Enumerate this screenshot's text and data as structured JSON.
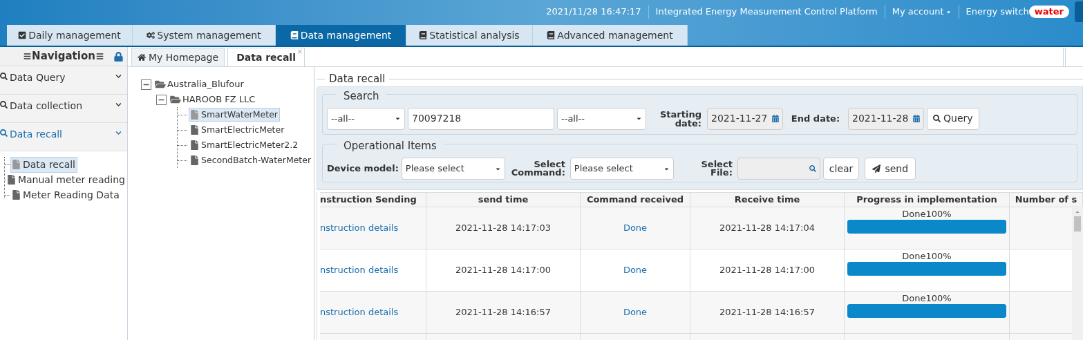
{
  "header": {
    "datetime": "2021/11/28 16:47:17",
    "platform": "Integrated Energy Measurement Control Platform",
    "account": "My account",
    "energy_label": "Energy switch",
    "energy_value": "water"
  },
  "top_tabs": [
    {
      "label": "Daily management",
      "selected": false
    },
    {
      "label": "System management",
      "selected": false
    },
    {
      "label": "Data management",
      "selected": true
    },
    {
      "label": "Statistical analysis",
      "selected": false
    },
    {
      "label": "Advanced management",
      "selected": false
    }
  ],
  "sidebar": {
    "title": "Navigation",
    "sections": [
      {
        "label": "Data Query",
        "selected": false
      },
      {
        "label": "Data collection",
        "selected": false
      },
      {
        "label": "Data recall",
        "selected": true
      }
    ],
    "items": [
      {
        "label": "Data recall",
        "selected": true
      },
      {
        "label": "Manual meter reading",
        "selected": false
      },
      {
        "label": "Meter Reading Data",
        "selected": false
      }
    ]
  },
  "content_tabs": [
    {
      "label": "My Homepage",
      "selected": false
    },
    {
      "label": "Data recall",
      "selected": true,
      "close": "×"
    }
  ],
  "tree": {
    "label": "Australia_Blufour",
    "expanded": true,
    "children": [
      {
        "label": "HAROOB FZ LLC",
        "expanded": true,
        "children": [
          {
            "label": "SmartWaterMeter",
            "selected": true
          },
          {
            "label": "SmartElectricMeter",
            "selected": false
          },
          {
            "label": "SmartElectricMeter2.2",
            "selected": false
          },
          {
            "label": "SecondBatch-WaterMeter",
            "selected": false
          }
        ]
      }
    ]
  },
  "panel": {
    "title": "Data recall",
    "search": {
      "title": "Search",
      "select_1": "--all--",
      "meter_number": "70097218",
      "select_2": "--all--",
      "start_label": "Starting date:",
      "start_value": "2021-11-27",
      "end_label": "End date:",
      "end_value": "2021-11-28",
      "query_button": "Query"
    },
    "operations": {
      "title": "Operational Items",
      "device_label": "Device model:",
      "device_value": "Please select",
      "command_label": "Select Command:",
      "command_value": "Please select",
      "file_label": "Select File:",
      "clear_button": "clear",
      "send_button": "send"
    }
  },
  "table": {
    "columns": [
      "nstruction Sending",
      "send time",
      "Command received",
      "Receive time",
      "Progress in implementation",
      "Number of s"
    ],
    "rows": [
      {
        "instruction": "nstruction details",
        "send_time": "2021-11-28 14:17:03",
        "command": "Done",
        "receive_time": "2021-11-28 14:17:04",
        "progress_label": "Done100%",
        "level": 1
      },
      {
        "instruction": "nstruction details",
        "send_time": "2021-11-28 14:17:00",
        "command": "Done",
        "receive_time": "2021-11-28 14:17:00",
        "progress_label": "Done100%",
        "level": 1
      },
      {
        "instruction": "nstruction details",
        "send_time": "2021-11-28 14:16:57",
        "command": "Done",
        "receive_time": "2021-11-28 14:16:57",
        "progress_label": "Done100%",
        "level": 1
      }
    ]
  }
}
